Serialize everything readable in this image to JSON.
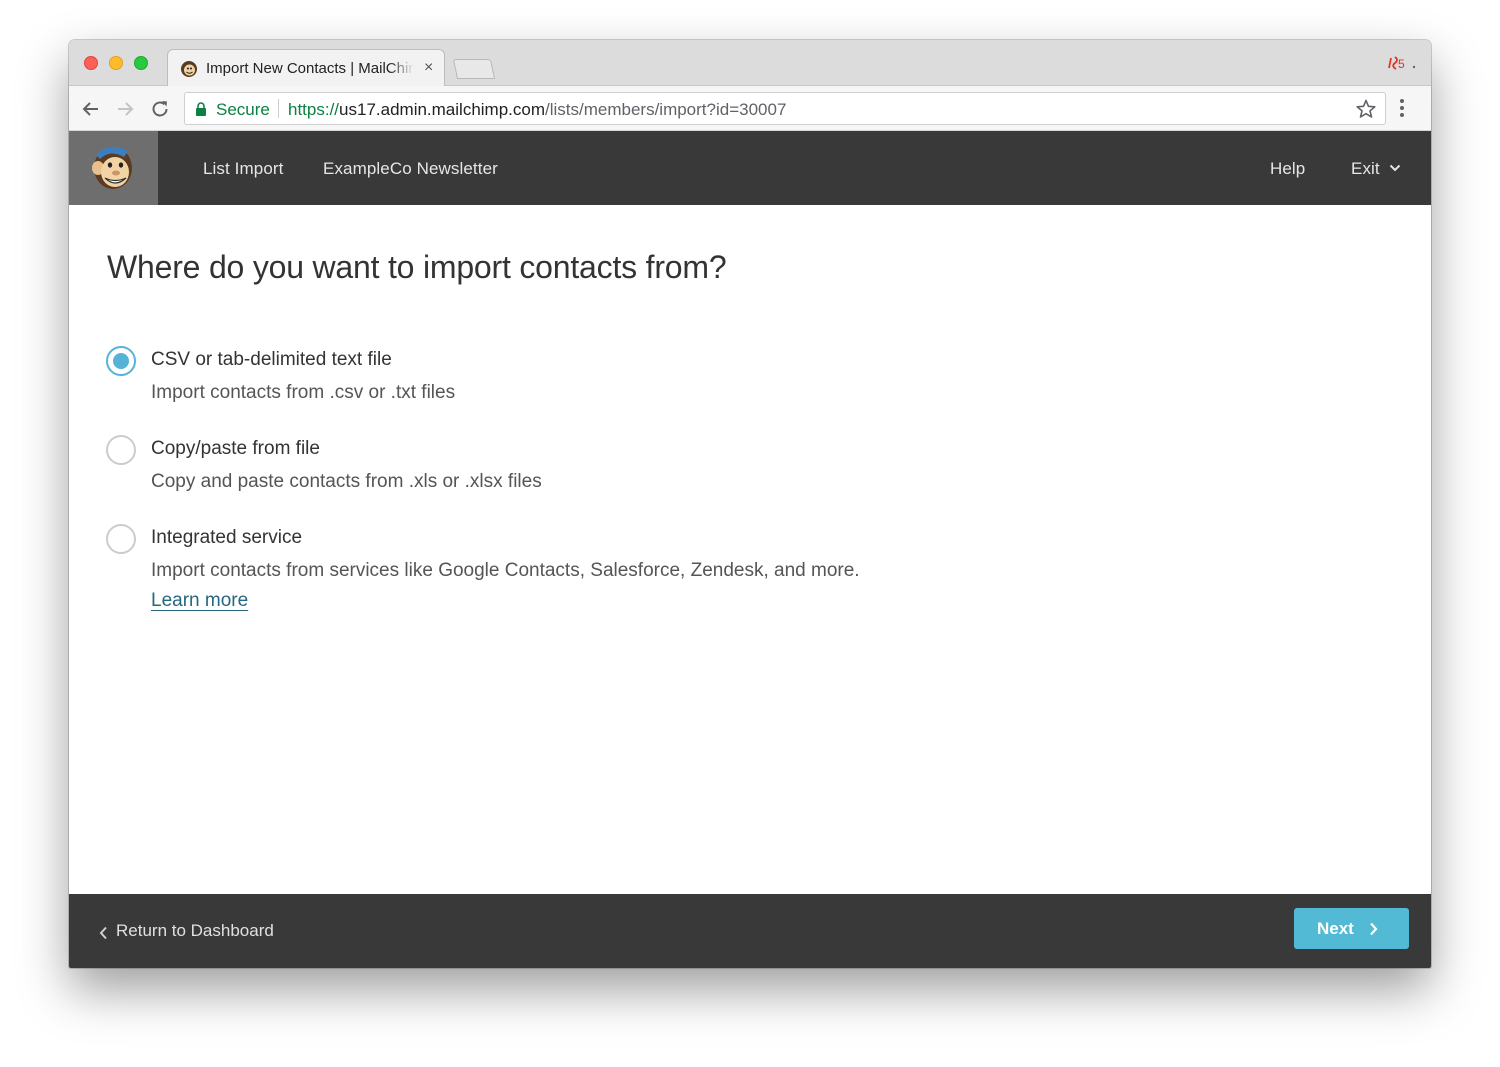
{
  "browser": {
    "tab_title": "Import New Contacts | MailChimp",
    "tab_close": "×",
    "secure_label": "Secure",
    "url_scheme": "https://",
    "url_host": "us17.admin.mailchimp.com",
    "url_path": "/lists/members/import?id=30007"
  },
  "header": {
    "nav": [
      "List Import",
      "ExampleCo Newsletter"
    ],
    "help_label": "Help",
    "exit_label": "Exit"
  },
  "main": {
    "title": "Where do you want to import contacts from?",
    "options": [
      {
        "label": "CSV or tab-delimited text file",
        "description": "Import contacts from .csv or .txt files",
        "selected": true
      },
      {
        "label": "Copy/paste from file",
        "description": "Copy and paste contacts from .xls or .xlsx files",
        "selected": false
      },
      {
        "label": "Integrated service",
        "description": "Import contacts from services like Google Contacts, Salesforce, Zendesk, and more.",
        "link": "Learn more",
        "selected": false
      }
    ]
  },
  "footer": {
    "back_label": "Return to Dashboard",
    "next_label": "Next"
  },
  "colors": {
    "accent": "#52bad5",
    "header_bg": "#393939",
    "link": "#24677f"
  }
}
